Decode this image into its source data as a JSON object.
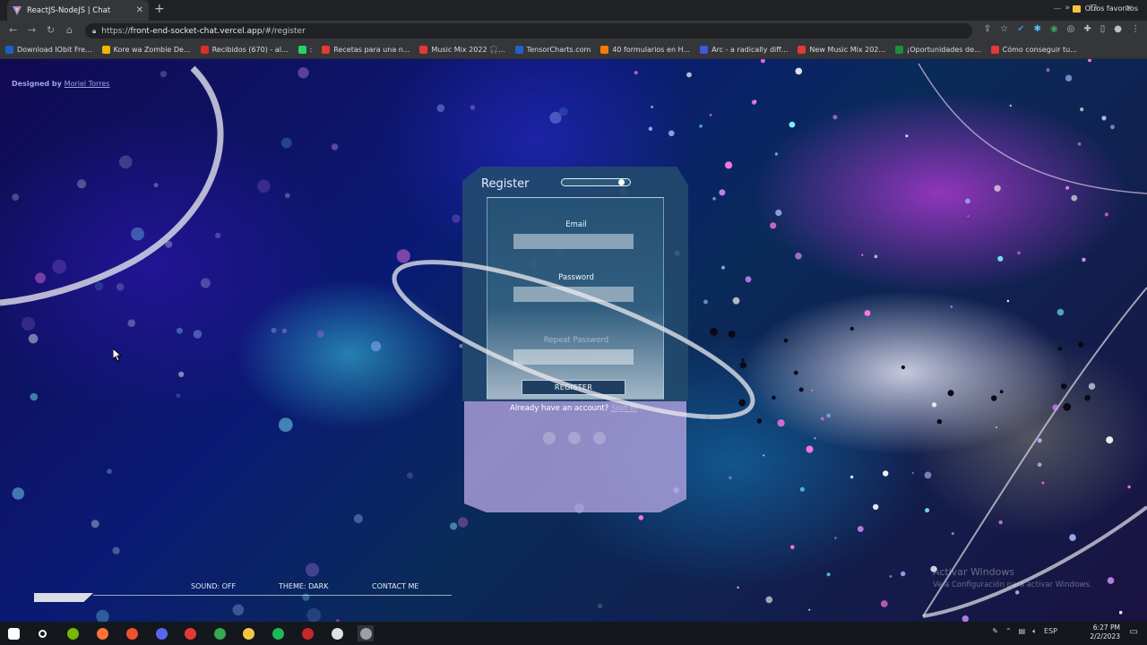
{
  "browser": {
    "tab_title": "ReactJS-NodeJS | Chat",
    "tab_close": "✕",
    "new_tab": "+",
    "url_prefix": "https://",
    "url_main": "front-end-socket-chat.vercel.app",
    "url_path": "/#/register",
    "bookmarks": [
      {
        "label": "Download IObit Fre...",
        "color": "#1565c0"
      },
      {
        "label": "Kore wa Zombie De...",
        "color": "#f4b400"
      },
      {
        "label": "Recibidos (670) - al...",
        "color": "#d93025"
      },
      {
        "label": ":",
        "color": "#25d366"
      },
      {
        "label": "Recetas para una n...",
        "color": "#e53935"
      },
      {
        "label": "Music Mix 2022 🎧...",
        "color": "#e53935"
      },
      {
        "label": "TensorCharts.com",
        "color": "#1e63c6"
      },
      {
        "label": "40 formularios en H...",
        "color": "#f57c00"
      },
      {
        "label": "Arc - a radically diff...",
        "color": "#3b5bdb"
      },
      {
        "label": "New Music Mix 202...",
        "color": "#e53935"
      },
      {
        "label": "¡Oportunidades de...",
        "color": "#1e8e3e"
      },
      {
        "label": "Cómo conseguir tu...",
        "color": "#e53935"
      }
    ],
    "bookmarks_more": "»",
    "other_bookmarks": "Otros favoritos"
  },
  "page": {
    "designed_prefix": "Designed by",
    "designer": "Moriel Torres",
    "card": {
      "title": "Register",
      "email_label": "Email",
      "password_label": "Password",
      "repeat_label": "Repeat Password",
      "email_value": "",
      "password_value": "",
      "repeat_value": "",
      "submit_label": "REGISTER",
      "already_text": "Already have an account?",
      "signin_link": "Sign in"
    },
    "footer": {
      "sound": "SOUND: OFF",
      "theme": "THEME: DARK",
      "contact": "CONTACT ME"
    },
    "watermark_title": "Activar Windows",
    "watermark_sub": "Ve a Configuración para activar Windows."
  },
  "taskbar": {
    "apps": [
      {
        "name": "start",
        "color": "#ffffff"
      },
      {
        "name": "search",
        "color": "#ffffff"
      },
      {
        "name": "nvidia",
        "color": "#76b900"
      },
      {
        "name": "firefox",
        "color": "#ff7139"
      },
      {
        "name": "git",
        "color": "#f05032"
      },
      {
        "name": "discord",
        "color": "#5865f2"
      },
      {
        "name": "app-red",
        "color": "#e53935"
      },
      {
        "name": "chrome",
        "color": "#34a853"
      },
      {
        "name": "files",
        "color": "#f4c542"
      },
      {
        "name": "spotify",
        "color": "#1db954"
      },
      {
        "name": "app-dark-red",
        "color": "#c62828"
      },
      {
        "name": "app-white",
        "color": "#e0e0e0"
      },
      {
        "name": "app-active",
        "color": "#9aa0a6"
      }
    ],
    "language": "ESP",
    "time": "6:27 PM",
    "date": "2/2/2023"
  },
  "colors": {
    "card_top": "#234b6e",
    "card_bottom": "#afa0dc",
    "button": "#1f3f60",
    "accent_link": "#9aa6e0"
  }
}
